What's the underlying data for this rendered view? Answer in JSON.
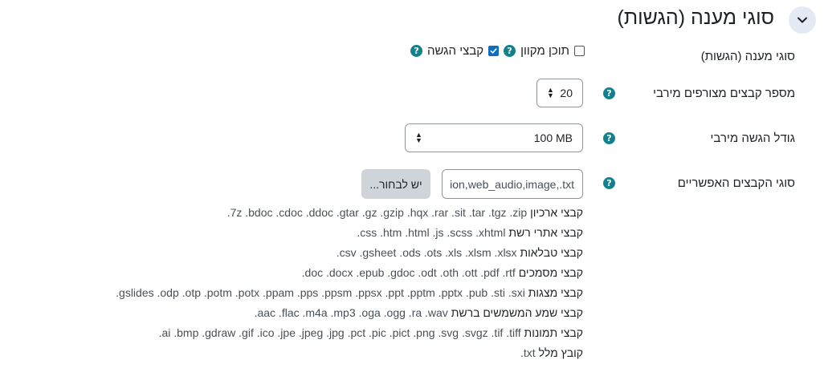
{
  "section": {
    "title": "סוגי מענה (הגשות)"
  },
  "submission_types": {
    "label": "סוגי מענה (הגשות)",
    "online_text_label": "תוכן מקוון",
    "online_text_checked": false,
    "file_submissions_label": "קבצי הגשה",
    "file_submissions_checked": true
  },
  "max_files": {
    "label": "מספר קבצים מצורפים מירבי",
    "value": "20"
  },
  "max_size": {
    "label": "גודל הגשה מירבי",
    "value": "100 MB"
  },
  "accepted_types": {
    "label": "סוגי הקבצים האפשריים",
    "input_value": "ion,web_audio,image,.txt",
    "choose_button": "יש לבחור...",
    "groups": [
      {
        "category": "קבצי ארכיון",
        "extensions": ".7z .bdoc .cdoc .ddoc .gtar .gz .gzip .hqx .rar .sit .tar .tgz .zip"
      },
      {
        "category": "קבצי אתרי רשת",
        "extensions": ".css .htm .html .js .scss .xhtml"
      },
      {
        "category": "קבצי טבלאות",
        "extensions": ".csv .gsheet .ods .ots .xls .xlsm .xlsx"
      },
      {
        "category": "קבצי מסמכים",
        "extensions": ".doc .docx .epub .gdoc .odt .oth .ott .pdf .rtf"
      },
      {
        "category": "קבצי מצגות",
        "extensions": ".gslides .odp .otp .potm .potx .ppam .pps .ppsm .ppsx .ppt .pptm .pptx .pub .sti .sxi"
      },
      {
        "category": "קבצי שמע המשמשים ברשת",
        "extensions": ".aac .flac .m4a .mp3 .oga .ogg .ra .wav"
      },
      {
        "category": "קבצי תמונות",
        "extensions": ".ai .bmp .gdraw .gif .ico .jpe .jpeg .jpg .pct .pic .pict .png .svg .svgz .tif .tiff"
      },
      {
        "category": "קובץ מלל",
        "extensions": ".txt"
      }
    ]
  },
  "colors": {
    "help_icon": "#11818e",
    "checkbox_checked": "#0f6cbf",
    "collapse_bg": "#e4eaf3"
  },
  "icons": {
    "collapse": "chevron-down-icon",
    "help": "question-circle-icon"
  }
}
